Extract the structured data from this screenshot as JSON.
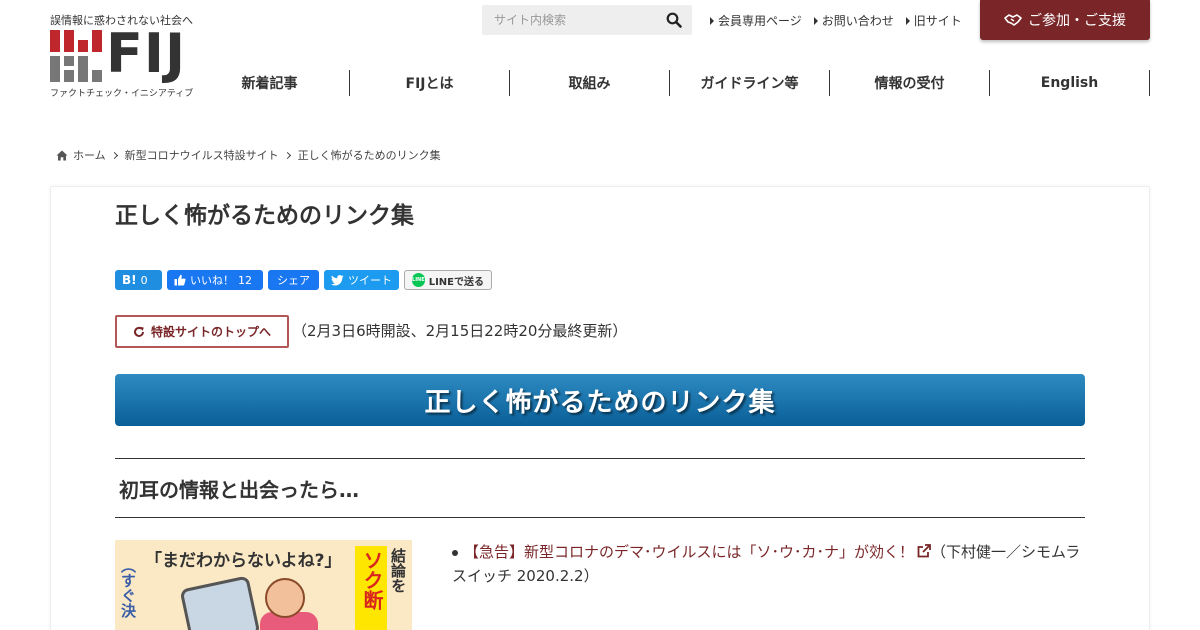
{
  "header": {
    "tagline": "誤情報に惑わされない社会へ",
    "logo_text": "FIJ",
    "logo_subtitle": "ファクトチェック・イニシアティブ",
    "search_placeholder": "サイト内検索",
    "top_links": [
      "会員専用ページ",
      "お問い合わせ",
      "旧サイト"
    ],
    "join_button": "ご参加・ご支援",
    "nav": [
      "新着記事",
      "FIJとは",
      "取組み",
      "ガイドライン等",
      "情報の受付",
      "English"
    ]
  },
  "breadcrumb": [
    "ホーム",
    "新型コロナウイルス特設サイト",
    "正しく怖がるためのリンク集"
  ],
  "article": {
    "title": "正しく怖がるためのリンク集",
    "share": {
      "hatena_label": "B!",
      "hatena_count": "0",
      "fb_like_label": "いいね！",
      "fb_like_count": "12",
      "fb_share_label": "シェア",
      "tweet_label": "ツイート",
      "line_label": "LINEで送る",
      "line_badge": "LINE"
    },
    "top_button": "特設サイトのトップへ",
    "update_note": "（2月3日6時開設、2月15日22時20分最終更新）",
    "banner_title": "正しく怖がるためのリンク集",
    "section_heading": "初耳の情報と出会ったら…",
    "thumbnail": {
      "quote": "「まだわからないよね?」",
      "yellow_text": "ソク断",
      "side_text": "結論を",
      "left_text": "（すぐ決"
    },
    "links": [
      {
        "title": "【急告】新型コロナのデマ･ウイルスには「ソ･ウ･カ･ナ」が効く！",
        "source": "（下村健一／シモムラスイッチ 2020.2.2）"
      }
    ]
  },
  "colors": {
    "brand": "#7a2628",
    "banner": "#0a5f98",
    "logo_red": "#c0272d",
    "logo_gray": "#777777"
  }
}
